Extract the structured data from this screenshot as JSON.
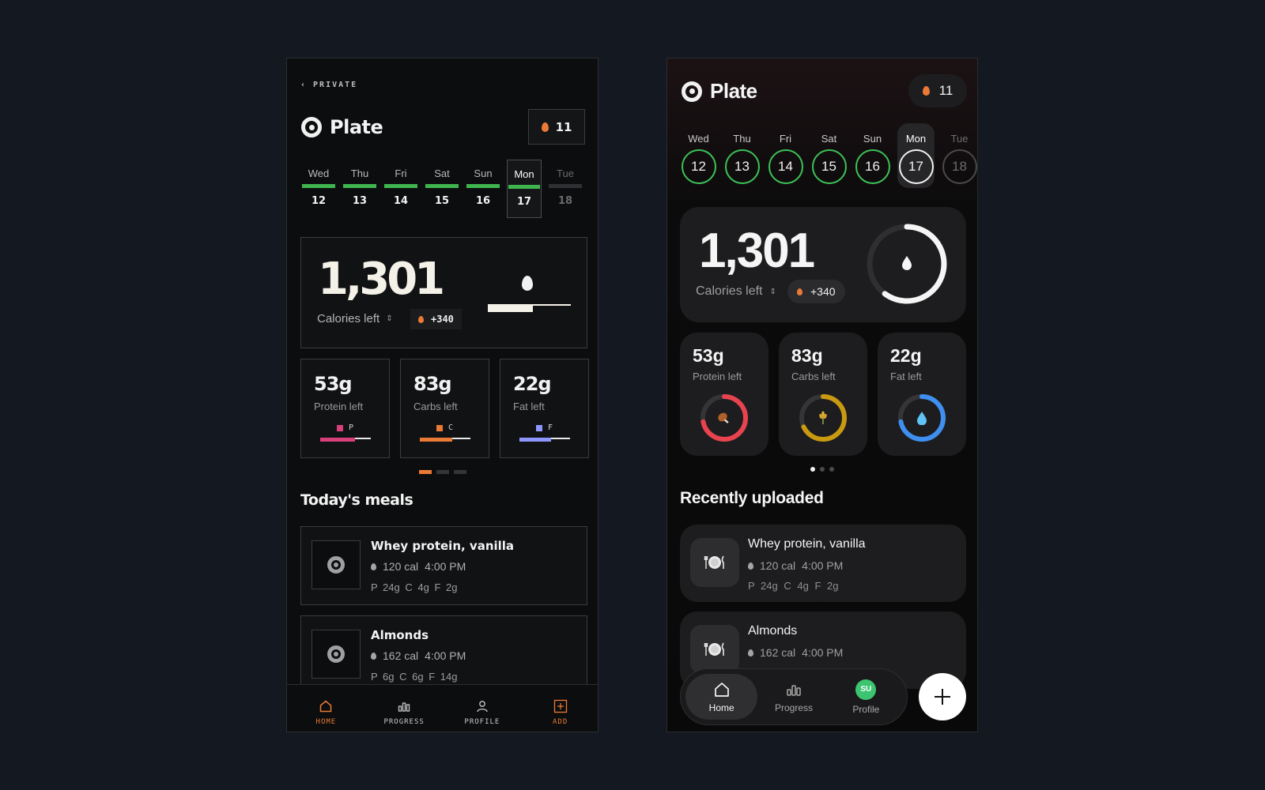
{
  "left_app": {
    "back_label": "‹ PRIVATE",
    "app_name": "Plate",
    "streak": "11",
    "days": [
      {
        "name": "Wed",
        "num": "12"
      },
      {
        "name": "Thu",
        "num": "13"
      },
      {
        "name": "Fri",
        "num": "14"
      },
      {
        "name": "Sat",
        "num": "15"
      },
      {
        "name": "Sun",
        "num": "16"
      },
      {
        "name": "Mon",
        "num": "17"
      },
      {
        "name": "Tue",
        "num": "18"
      }
    ],
    "calories": {
      "value": "1,301",
      "label": "Calories left",
      "bonus": "+340",
      "progress": 0.54
    },
    "macros": [
      {
        "amount": "53g",
        "label": "Protein left",
        "tag": "P",
        "color": "#d8407a",
        "progress": 0.68
      },
      {
        "amount": "83g",
        "label": "Carbs left",
        "tag": "C",
        "color": "#ea7a35",
        "progress": 0.64
      },
      {
        "amount": "22g",
        "label": "Fat left",
        "tag": "F",
        "color": "#8f96ff",
        "progress": 0.62
      }
    ],
    "section_title": "Today's meals",
    "meals": [
      {
        "name": "Whey protein, vanilla",
        "cal": "120 cal",
        "time": "4:00 PM",
        "p": "P 24g",
        "c": "C 4g",
        "f": "F 2g"
      },
      {
        "name": "Almonds",
        "cal": "162 cal",
        "time": "4:00 PM",
        "p": "P 6g",
        "c": "C 6g",
        "f": "F 14g"
      }
    ],
    "nav": {
      "home": "HOME",
      "progress": "PROGRESS",
      "profile": "PROFILE",
      "add": "ADD"
    }
  },
  "right_app": {
    "app_name": "Plate",
    "streak": "11",
    "days": [
      {
        "name": "Wed",
        "num": "12"
      },
      {
        "name": "Thu",
        "num": "13"
      },
      {
        "name": "Fri",
        "num": "14"
      },
      {
        "name": "Sat",
        "num": "15"
      },
      {
        "name": "Sun",
        "num": "16"
      },
      {
        "name": "Mon",
        "num": "17"
      },
      {
        "name": "Tue",
        "num": "18"
      }
    ],
    "calories": {
      "value": "1,301",
      "label": "Calories left",
      "bonus": "+340",
      "progress": 0.6
    },
    "macros": [
      {
        "amount": "53g",
        "label": "Protein left",
        "color": "#e8434e",
        "progress": 0.72,
        "icon": "drumstick-icon"
      },
      {
        "amount": "83g",
        "label": "Carbs left",
        "color": "#c99a10",
        "progress": 0.68,
        "icon": "wheat-icon"
      },
      {
        "amount": "22g",
        "label": "Fat left",
        "color": "#3f8ff0",
        "progress": 0.72,
        "icon": "water-drop-icon"
      }
    ],
    "section_title": "Recently uploaded",
    "meals": [
      {
        "name": "Whey protein, vanilla",
        "cal": "120 cal",
        "time": "4:00 PM",
        "p": "P 24g",
        "c": "C 4g",
        "f": "F 2g"
      },
      {
        "name": "Almonds",
        "cal": "162 cal",
        "time": "4:00 PM"
      }
    ],
    "nav": {
      "home": "Home",
      "progress": "Progress",
      "profile": "Profile",
      "avatar_initials": "SU"
    }
  }
}
